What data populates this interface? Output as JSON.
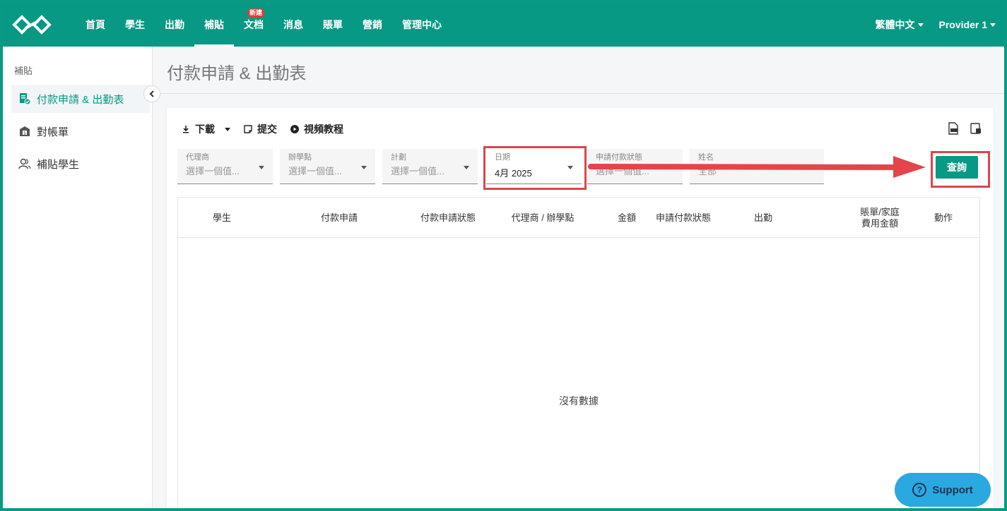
{
  "nav": {
    "items": [
      {
        "label": "首頁",
        "active": false
      },
      {
        "label": "學生",
        "active": false
      },
      {
        "label": "出勤",
        "active": false
      },
      {
        "label": "補貼",
        "active": true
      },
      {
        "label": "文档",
        "active": false,
        "badge": "新建"
      },
      {
        "label": "消息",
        "active": false
      },
      {
        "label": "賬單",
        "active": false
      },
      {
        "label": "營銷",
        "active": false
      },
      {
        "label": "管理中心",
        "active": false
      }
    ],
    "language": "繁體中文",
    "account": "Provider 1"
  },
  "sidebar": {
    "heading": "補貼",
    "items": [
      {
        "label": "付款申請 & 出勤表",
        "icon": "document-icon",
        "active": true
      },
      {
        "label": "對帳單",
        "icon": "statement-icon",
        "active": false
      },
      {
        "label": "補貼學生",
        "icon": "people-icon",
        "active": false
      }
    ]
  },
  "page": {
    "title": "付款申請 & 出勤表"
  },
  "toolbar": {
    "download": "下載",
    "submit": "提交",
    "video": "視頻教程"
  },
  "filters": {
    "agency": {
      "label": "代理商",
      "placeholder": "選擇一個值..."
    },
    "school": {
      "label": "辦學點",
      "placeholder": "選擇一個值..."
    },
    "plan": {
      "label": "計劃",
      "placeholder": "選擇一個值..."
    },
    "date": {
      "label": "日期",
      "value": "4月 2025"
    },
    "status": {
      "label": "申請付款狀態",
      "placeholder": "選擇一個值..."
    },
    "name": {
      "label": "姓名",
      "placeholder": "全部"
    }
  },
  "query_button": "查詢",
  "table": {
    "headers": [
      "學生",
      "付款申請",
      "付款申請狀態",
      "代理商 / 辦學點",
      "金額",
      "申請付款狀態",
      "出勤",
      "賬單/家庭費用金額",
      "動作"
    ],
    "header_lines": {
      "bill_1": "賬單/家庭",
      "bill_2": "費用金額"
    },
    "empty": "沒有數據"
  },
  "support": "Support",
  "colors": {
    "brand": "#089985",
    "annotation": "#d9474b",
    "support": "#2aa8e0"
  }
}
